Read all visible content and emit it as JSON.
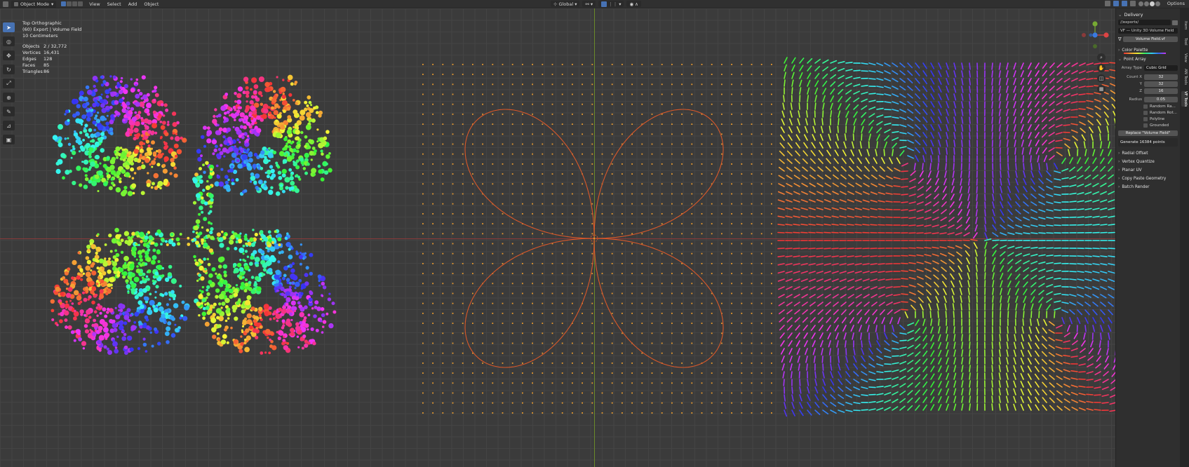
{
  "header": {
    "mode": "Object Mode",
    "menus": [
      "View",
      "Select",
      "Add",
      "Object"
    ],
    "orientation": "Global",
    "options_label": "Options"
  },
  "overlay": {
    "view_name": "Top Orthographic",
    "collection": "(60) Export | Volume Field",
    "scale": "10 Centimeters",
    "stats": [
      {
        "key": "Objects",
        "value": "2 / 32,772"
      },
      {
        "key": "Vertices",
        "value": "16,431"
      },
      {
        "key": "Edges",
        "value": "128"
      },
      {
        "key": "Faces",
        "value": "85"
      },
      {
        "key": "Triangles",
        "value": "86"
      }
    ]
  },
  "panel": {
    "title": "Delivery",
    "export_path": "//exports/",
    "format": "VF — Unity 3D Volume Field",
    "file_name": "Volume Field.vf",
    "color_palette": "Color Palette",
    "point_array": "Point Array",
    "array_type_label": "Array Type",
    "array_type": "Cubic Grid",
    "count_x_label": "Count X",
    "count_x": "32",
    "y_label": "Y",
    "y": "32",
    "z_label": "Z",
    "z": "16",
    "radius_label": "Radius",
    "radius": "0.05",
    "checks": [
      "Random Ra...",
      "Random Rot...",
      "Polyline",
      "Grounded"
    ],
    "replace_button": "Replace \"Volume Field\"",
    "generate_button": "Generate 16384 points",
    "sections": [
      "Radial Offset",
      "Vertex Quantize",
      "Planar UV",
      "Copy Paste Geometry",
      "Batch Render"
    ]
  },
  "sidebar_tabs": [
    "Item",
    "Tool",
    "View",
    "AN Tools",
    "VF Tools"
  ],
  "colors": {
    "accent": "#4772b3",
    "curve": "#d9582a",
    "dots": "#e89a2e",
    "axis_x": "#8a3a3a",
    "axis_y": "#6a8a2a"
  }
}
